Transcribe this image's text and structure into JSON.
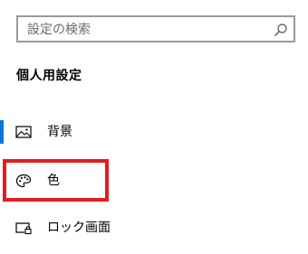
{
  "search": {
    "placeholder": "設定の検索",
    "value": "",
    "icon": "search-icon"
  },
  "section": {
    "title": "個人用設定"
  },
  "nav": {
    "items": [
      {
        "label": "背景",
        "icon": "picture-icon",
        "selected": true
      },
      {
        "label": "色",
        "icon": "palette-icon",
        "selected": false
      },
      {
        "label": "ロック画面",
        "icon": "lock-screen-icon",
        "selected": false
      }
    ]
  },
  "colors": {
    "accent": "#0078d7",
    "highlight": "#e11d23",
    "search_border": "#9a9a9a"
  }
}
